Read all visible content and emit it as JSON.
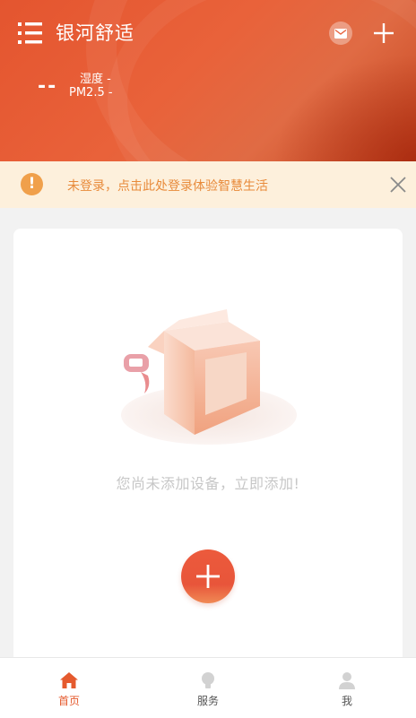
{
  "header": {
    "title": "银河舒适",
    "temperature": "--",
    "humidity_label": "湿度 -",
    "pm25_label": "PM2.5 -",
    "icons": [
      "menu-icon",
      "mail-icon",
      "plus-icon"
    ]
  },
  "notice": {
    "text": "未登录，点击此处登录体验智慧生活",
    "warn_symbol": "!",
    "icons": [
      "warning-icon",
      "close-icon"
    ]
  },
  "empty_state": {
    "text": "您尚未添加设备，立即添加!",
    "icons": [
      "empty-box-illustration",
      "add-icon"
    ]
  },
  "tabbar": {
    "tabs": [
      {
        "label": "首页",
        "icon": "home-icon",
        "active": true
      },
      {
        "label": "服务",
        "icon": "lightbulb-icon",
        "active": false
      },
      {
        "label": "我",
        "icon": "user-icon",
        "active": false
      }
    ]
  },
  "colors": {
    "brand": "#e4552f",
    "notice_bg": "#fdf0dc",
    "notice_text": "#e88a3a",
    "active_tab": "#e55a2e"
  }
}
